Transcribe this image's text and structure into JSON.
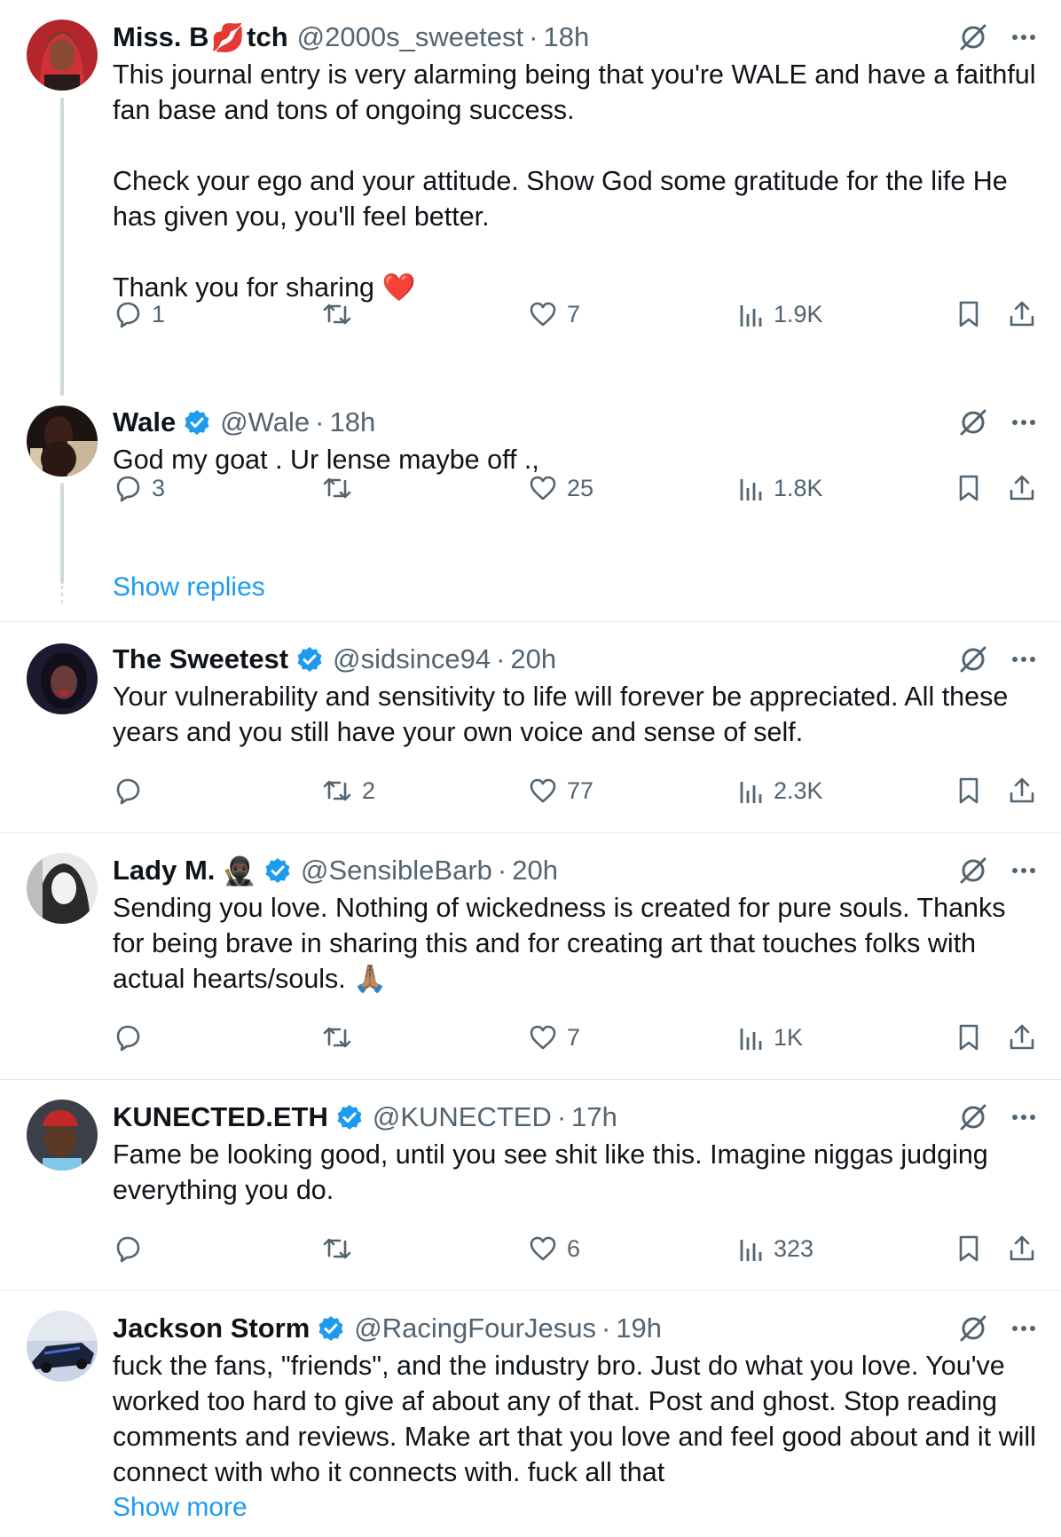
{
  "tweets": [
    {
      "name": "Miss. B",
      "name_emoji": "💋",
      "name_suffix": "tch",
      "handle": "@2000s_sweetest",
      "dot": "·",
      "time": "18h",
      "text": "This journal entry is very alarming being that you're WALE and have a faithful fan base and tons of ongoing success.\n\nCheck your ego and your attitude. Show God some gratitude for the life He has given you, you'll feel better.\n\nThank you for sharing ❤️",
      "replies": "1",
      "retweets": "",
      "likes": "7",
      "views": "1.9K"
    },
    {
      "name": "Wale",
      "handle": "@Wale",
      "dot": "·",
      "time": "18h",
      "text": "God my goat . Ur lense maybe off .,",
      "replies": "3",
      "retweets": "",
      "likes": "25",
      "views": "1.8K"
    },
    {
      "name": "The Sweetest",
      "handle": "@sidsince94",
      "dot": "·",
      "time": "20h",
      "text": "Your vulnerability and sensitivity to life will forever be appreciated. All these years and you still have your own voice and sense of self.",
      "replies": "",
      "retweets": "2",
      "likes": "77",
      "views": "2.3K"
    },
    {
      "name": "Lady M.",
      "name_emoji": "🥷🏿",
      "handle": "@SensibleBarb",
      "dot": "·",
      "time": "20h",
      "text": "Sending you love. Nothing of wickedness is created for pure souls. Thanks for being brave in sharing this and for creating art that touches folks with actual hearts/souls. 🙏🏽",
      "replies": "",
      "retweets": "",
      "likes": "7",
      "views": "1K"
    },
    {
      "name": "KUNECTED.ETH",
      "handle": "@KUNECTED",
      "dot": "·",
      "time": "17h",
      "text": "Fame be looking good, until you see shit like this. Imagine niggas judging everything you do.",
      "replies": "",
      "retweets": "",
      "likes": "6",
      "views": "323"
    },
    {
      "name": "Jackson Storm",
      "handle": "@RacingFourJesus",
      "dot": "·",
      "time": "19h",
      "text": "fuck the fans, \"friends\", and the industry bro. Just do what you love. You've worked too hard to give af about any of that. Post and ghost. Stop reading comments and reviews. Make art that you love and feel good about and it will connect with who it connects with. fuck all that"
    }
  ],
  "show_replies": "Show replies",
  "show_more": "Show more",
  "icons": {
    "verified": "verified-badge-icon",
    "grok": "grok-icon",
    "more": "more-icon",
    "reply": "reply-icon",
    "retweet": "retweet-icon",
    "like": "like-icon",
    "views": "views-icon",
    "bookmark": "bookmark-icon",
    "share": "share-icon"
  },
  "colors": {
    "accent": "#1d9bf0",
    "secondary_text": "#536471",
    "thread_line": "#cfd9de",
    "separator": "#e6e9eb"
  }
}
